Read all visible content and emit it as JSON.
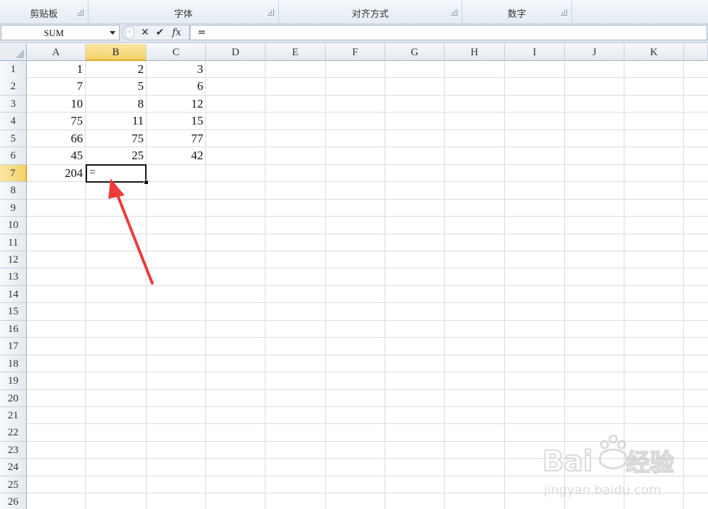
{
  "ribbon": {
    "groups": [
      {
        "label": "剪贴板"
      },
      {
        "label": "字体"
      },
      {
        "label": "对齐方式"
      },
      {
        "label": "数字"
      }
    ]
  },
  "formula_bar": {
    "name_box": "SUM",
    "cancel_icon": "✕",
    "enter_icon": "✔",
    "fx_label": "fx",
    "content": "="
  },
  "columns": [
    "A",
    "B",
    "C",
    "D",
    "E",
    "F",
    "G",
    "H",
    "I",
    "J",
    "K"
  ],
  "selected_column": "B",
  "rows": [
    "1",
    "2",
    "3",
    "4",
    "5",
    "6",
    "7",
    "8",
    "9",
    "10",
    "11",
    "12",
    "13",
    "14",
    "15",
    "16",
    "17",
    "18",
    "19",
    "20",
    "21",
    "22",
    "23",
    "24",
    "25",
    "26"
  ],
  "selected_row": "7",
  "cells": {
    "A1": "1",
    "B1": "2",
    "C1": "3",
    "A2": "7",
    "B2": "5",
    "C2": "6",
    "A3": "10",
    "B3": "8",
    "C3": "12",
    "A4": "75",
    "B4": "11",
    "C4": "15",
    "A5": "66",
    "B5": "75",
    "C5": "77",
    "A6": "45",
    "B6": "25",
    "C6": "42",
    "A7": "204"
  },
  "active_cell": {
    "ref": "B7",
    "value": "="
  },
  "colors": {
    "accent": "#f6d26b",
    "arrow": "#ee3b3b"
  },
  "watermark": {
    "brand": "Bai du 经验",
    "url": "jingyan.baidu.com"
  }
}
